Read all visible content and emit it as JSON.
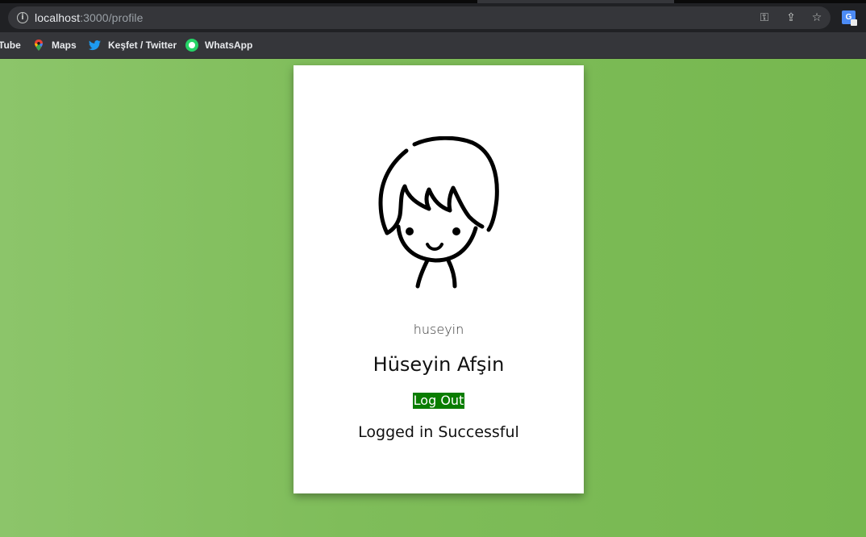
{
  "browser": {
    "url_host": "localhost",
    "url_rest": ":3000/profile",
    "bookmarks": [
      {
        "label": "Tube",
        "icon": "youtube-icon"
      },
      {
        "label": "Maps",
        "icon": "maps-icon"
      },
      {
        "label": "Keşfet / Twitter",
        "icon": "twitter-icon"
      },
      {
        "label": "WhatsApp",
        "icon": "whatsapp-icon"
      }
    ]
  },
  "profile": {
    "username": "huseyin",
    "full_name": "Hüseyin Afşin",
    "logout_label": "Log Out",
    "status_message": "Logged in Successful"
  },
  "colors": {
    "background": "#7ab853",
    "logout_bg": "#0a7d00"
  }
}
